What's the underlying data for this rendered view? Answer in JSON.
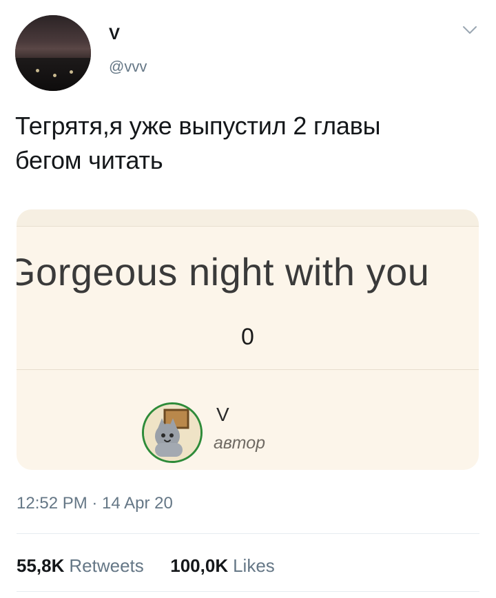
{
  "tweet": {
    "name": "V",
    "handle": "@vvv",
    "text_line1": "Тегрятя,я уже выпустил 2 главы",
    "text_line2": "бегом читать",
    "timestamp": "12:52 PM · 14 Apr 20"
  },
  "card": {
    "title": "Gorgeous night with you",
    "subtitle": "0",
    "author_name": "V",
    "author_role": "автор"
  },
  "stats": {
    "retweets_count": "55,8K",
    "retweets_label": "Retweets",
    "likes_count": "100,0K",
    "likes_label": "Likes"
  },
  "colors": {
    "text_primary": "#14171a",
    "text_secondary": "#657786",
    "card_bg": "#fcf5ea",
    "author_ring": "#2e8b39"
  },
  "icons": {
    "menu": "chevron-down-icon"
  }
}
